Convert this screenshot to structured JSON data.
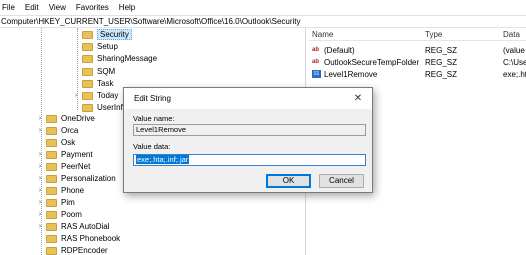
{
  "menu": [
    "File",
    "Edit",
    "View",
    "Favorites",
    "Help"
  ],
  "address": "Computer\\HKEY_CURRENT_USER\\Software\\Microsoft\\Office\\16.0\\Outlook\\Security",
  "tree": {
    "upper": [
      {
        "label": "Security",
        "selected": true
      },
      {
        "label": "Setup"
      },
      {
        "label": "SharingMessage"
      },
      {
        "label": "SQM"
      },
      {
        "label": "Task"
      },
      {
        "label": "Today"
      },
      {
        "label": "UserInfo"
      }
    ],
    "lower": [
      {
        "label": "OneDrive"
      },
      {
        "label": "Orca"
      },
      {
        "label": "Osk"
      },
      {
        "label": "Payment"
      },
      {
        "label": "PeerNet"
      },
      {
        "label": "Personalization"
      },
      {
        "label": "Phone"
      },
      {
        "label": "Pim"
      },
      {
        "label": "Poom"
      },
      {
        "label": "RAS AutoDial"
      },
      {
        "label": "RAS Phonebook"
      },
      {
        "label": "RDPEncoder"
      }
    ]
  },
  "values": {
    "headers": {
      "name": "Name",
      "type": "Type",
      "data": "Data"
    },
    "rows": [
      {
        "name": "(Default)",
        "type": "REG_SZ",
        "data": "(value"
      },
      {
        "name": "OutlookSecureTempFolder",
        "type": "REG_SZ",
        "data": "C:\\Use"
      },
      {
        "name": "Level1Remove",
        "type": "REG_SZ",
        "data": "exe;.ht"
      }
    ]
  },
  "dialog": {
    "title": "Edit String",
    "close_glyph": "✕",
    "value_name_label": "Value name:",
    "value_name": "Level1Remove",
    "value_data_label": "Value data:",
    "value_data": "exe;.hta;.inf;.jar",
    "ok_label": "OK",
    "cancel_label": "Cancel"
  }
}
